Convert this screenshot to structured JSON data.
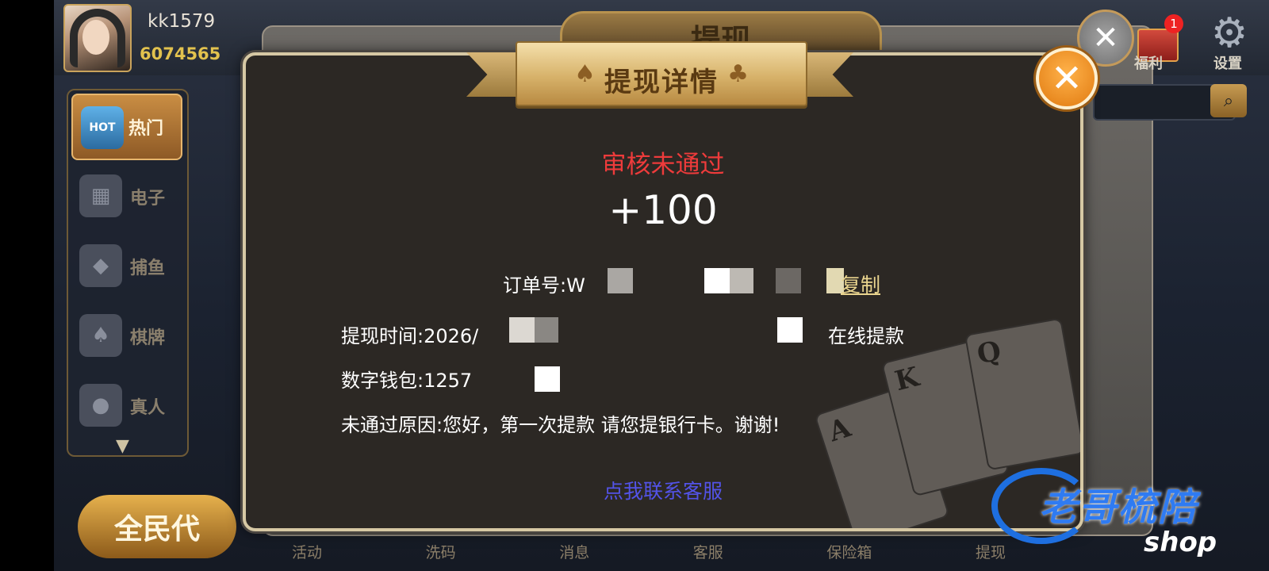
{
  "player": {
    "username": "kk1579",
    "gold": "6074565"
  },
  "sidebar": {
    "items": [
      {
        "label": "热门",
        "badge": "HOT"
      },
      {
        "label": "电子"
      },
      {
        "label": "捕鱼"
      },
      {
        "label": "棋牌"
      },
      {
        "label": "真人"
      }
    ]
  },
  "top_right": {
    "gift_label": "福利",
    "gift_badge": "1",
    "settings_label": "设置"
  },
  "background_title": "提现",
  "promo_label": "全民代",
  "bottom_nav": [
    "活动",
    "洗码",
    "消息",
    "客服",
    "保险箱",
    "提现"
  ],
  "dialog": {
    "title": "提现详情",
    "status": "审核未通过",
    "amount": "+100",
    "order_label": "订单号:W",
    "copy_label": "复制",
    "time_label": "提现时间:2026/",
    "method_value": "在线提款",
    "wallet_label": "数字钱包:1257",
    "reason_label": "未通过原因:您好，第一次提款 请您提银行卡。谢谢!",
    "contact_label": "点我联系客服"
  },
  "watermark": {
    "text": "老哥梳陪",
    "sub": "shop"
  },
  "colors": {
    "status": "#ee3b3b",
    "contact": "#5353e8",
    "copy": "#e9d48e"
  }
}
